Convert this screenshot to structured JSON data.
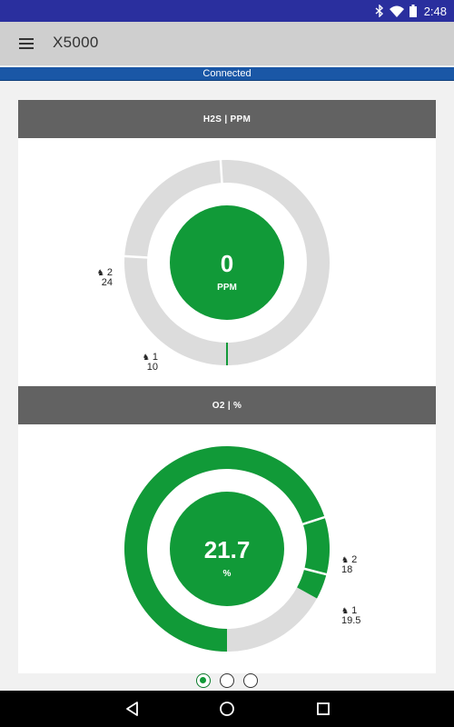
{
  "status_bar": {
    "time": "2:48",
    "icons": [
      "bluetooth-icon",
      "wifi-icon",
      "battery-icon"
    ]
  },
  "app_bar": {
    "menu_icon": "hamburger-menu-icon",
    "title": "X5000"
  },
  "connection": {
    "status": "Connected"
  },
  "sensors": [
    {
      "header": "H2S | PPM",
      "value": "0",
      "unit": "PPM",
      "reading_fraction": 0.0,
      "alarm1_fraction": 0.26,
      "alarm2_fraction": 0.49,
      "alarms": [
        {
          "level": "1",
          "value": "10",
          "icon": "alarm-bell-icon"
        },
        {
          "level": "2",
          "value": "24",
          "icon": "alarm-bell-icon"
        }
      ]
    },
    {
      "header": "O2 | %",
      "value": "21.7",
      "unit": "%",
      "reading_fraction": 0.83,
      "alarm1_fraction": 0.79,
      "alarm2_fraction": 0.7,
      "alarms": [
        {
          "level": "2",
          "value": "18",
          "icon": "alarm-bell-icon"
        },
        {
          "level": "1",
          "value": "19.5",
          "icon": "alarm-bell-icon"
        }
      ]
    }
  ],
  "pager": {
    "pages": 3,
    "active": 0
  },
  "nav_bar": {
    "icons": [
      "back-icon",
      "home-icon",
      "recents-icon"
    ]
  },
  "colors": {
    "status_bar": "#2a2f9e",
    "app_bar": "#cfcfcf",
    "connected": "#1a57a6",
    "gauge_green": "#119a38",
    "gauge_track": "#dcdcdc",
    "card_header": "#626262"
  }
}
